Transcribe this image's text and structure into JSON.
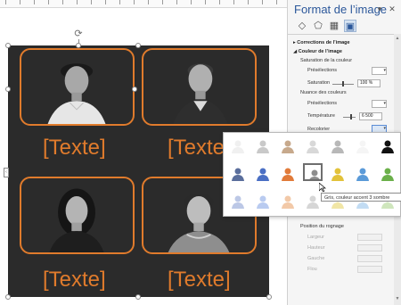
{
  "canvas": {
    "text_placeholders": [
      "[Texte]",
      "[Texte]",
      "[Texte]",
      "[Texte]"
    ],
    "accent_color": "#e07b2c",
    "slide_color": "#2b2b2b"
  },
  "panel": {
    "title": "Format de l’image",
    "tabs": [
      "fill-line-icon",
      "effects-icon",
      "size-properties-icon",
      "picture-icon"
    ],
    "sections": {
      "corrections": "Corrections de l’image",
      "color": "Couleur de l’image",
      "saturation_heading": "Saturation de la couleur",
      "presets1": "Présélections",
      "saturation": "Saturation",
      "saturation_value": "100 %",
      "tone_heading": "Nuance des couleurs",
      "presets2": "Présélections",
      "temperature": "Température",
      "temperature_value": "6 500",
      "recolor": "Recolorier",
      "crop_position": "Position du rognage",
      "width": "Largeur",
      "height": "Hauteur",
      "left": "Gauche",
      "blur": "Flou"
    }
  },
  "recolor_popup": {
    "tooltip": "Gris, couleur accent 3 sombre",
    "rows": [
      [
        "#f0f0f0",
        "#c9c9c9",
        "#c7a98c",
        "#d8d8d8",
        "#b8b8b8",
        "#f5f5f5",
        "#111111"
      ],
      [
        "#5a6e9c",
        "#4a6fc4",
        "#e17b3a",
        "#8e8e8e",
        "#e2c23a",
        "#5a9ad8",
        "#6bb04a"
      ],
      [
        "#bcc8e6",
        "#b9cbf0",
        "#f2c9a8",
        "#d6d6d6",
        "#f1e6a6",
        "#c2dcf3",
        "#cfe6bd"
      ]
    ],
    "selected": "row2-col4"
  }
}
